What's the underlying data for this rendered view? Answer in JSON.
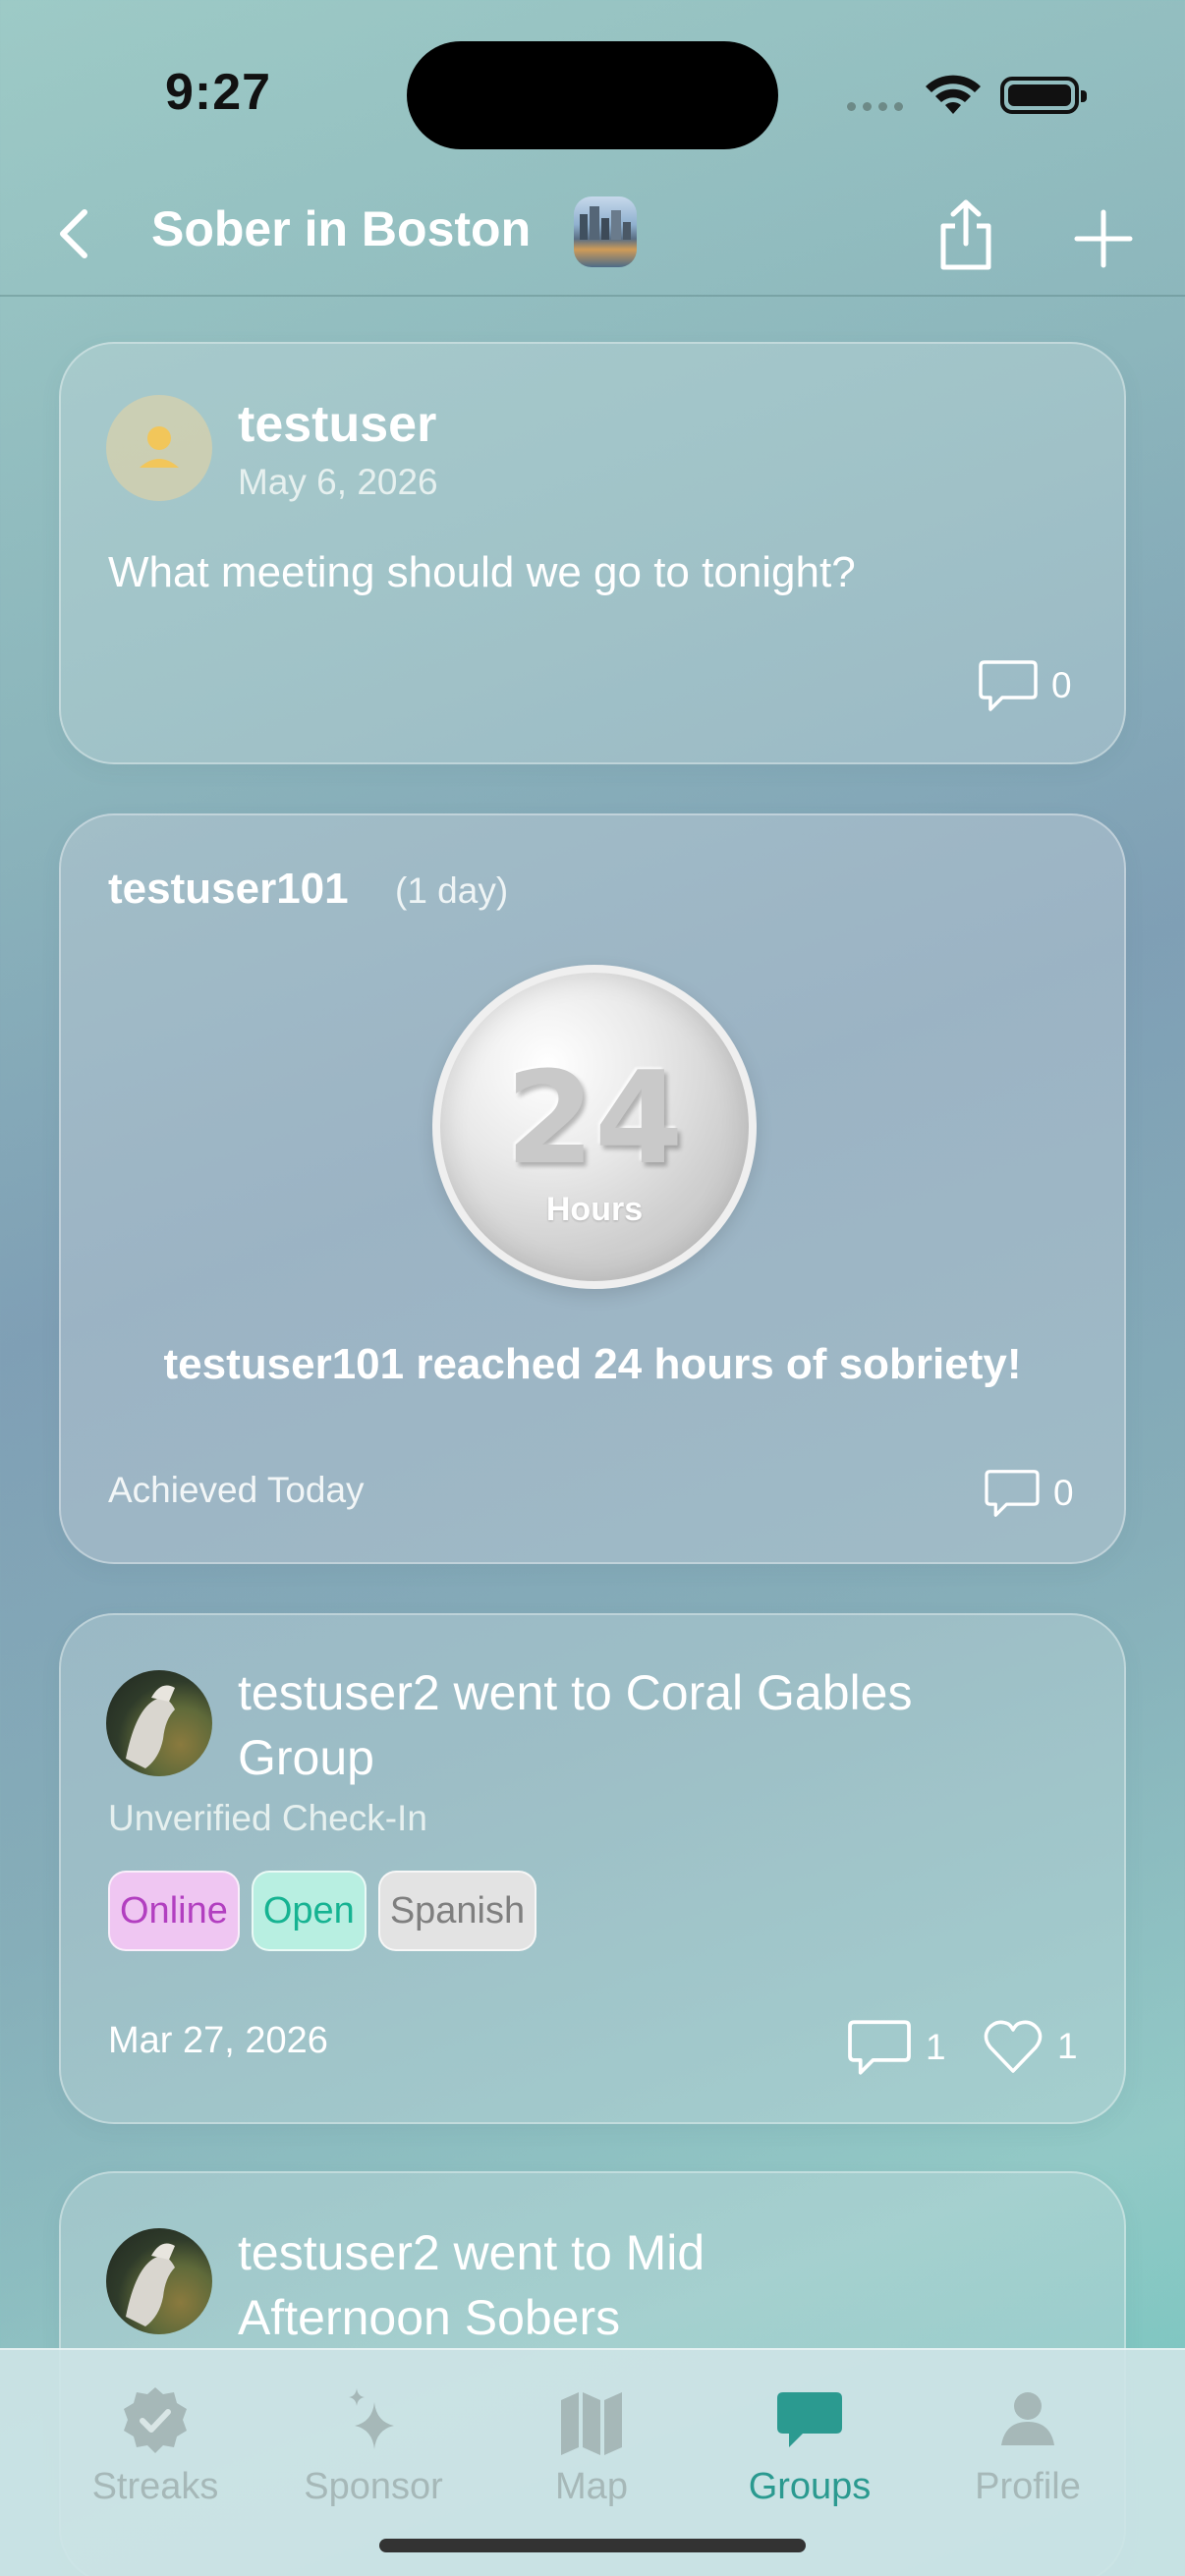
{
  "status_bar": {
    "time": "9:27"
  },
  "nav": {
    "title": "Sober in Boston"
  },
  "feed": {
    "post": {
      "username": "testuser",
      "date": "May 6, 2026",
      "text": "What meeting should we go to tonight?",
      "comment_count": "0"
    },
    "milestone": {
      "username": "testuser101",
      "days": "(1 day)",
      "coin_number": "24",
      "coin_unit": "Hours",
      "headline": "testuser101 reached 24 hours of sobriety!",
      "footer": "Achieved Today",
      "comment_count": "0"
    },
    "checkin1": {
      "title": "testuser2 went to Coral Gables Group",
      "subtitle": "Unverified Check-In",
      "tags": [
        "Online",
        "Open",
        "Spanish"
      ],
      "date": "Mar 27, 2026",
      "comment_count": "1",
      "like_count": "1"
    },
    "checkin2": {
      "title": "testuser2 went to Mid Afternoon Sobers"
    }
  },
  "tabbar": {
    "tabs": [
      {
        "label": "Streaks",
        "icon": "seal-check-icon"
      },
      {
        "label": "Sponsor",
        "icon": "sparkles-icon"
      },
      {
        "label": "Map",
        "icon": "map-icon"
      },
      {
        "label": "Groups",
        "icon": "chat-bubble-icon"
      },
      {
        "label": "Profile",
        "icon": "person-icon"
      }
    ],
    "active_color": "#2b9a90",
    "inactive_color": "#a6b8b8"
  }
}
